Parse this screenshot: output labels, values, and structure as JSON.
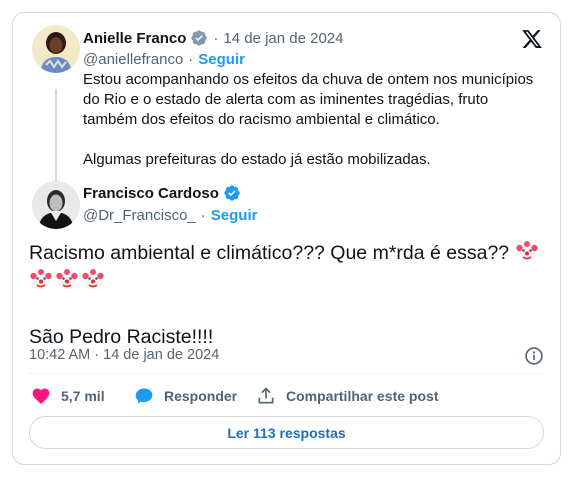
{
  "quoted_tweet": {
    "author_name": "Anielle Franco",
    "date": "14 de jan de 2024",
    "handle": "@aniellefranco",
    "separator": "·",
    "follow_label": "Seguir",
    "text_paragraph_1": "Estou acompanhando os efeitos da chuva de ontem nos municípios do Rio e o estado de alerta com as iminentes tragédias, fruto também dos efeitos do racismo ambiental e climático.",
    "text_paragraph_2": "Algumas prefeituras do estado já estão mobilizadas."
  },
  "main_tweet": {
    "author_name": "Francisco Cardoso",
    "handle": "@Dr_Francisco_",
    "separator": "·",
    "follow_label": "Seguir",
    "text_line_1": "Racismo ambiental e climático??? Que m*rda é essa??",
    "text_line_2": "São Pedro Raciste!!!!",
    "emojis": [
      "clown-face",
      "clown-face",
      "clown-face",
      "clown-face"
    ],
    "timestamp": "10:42 AM · 14 de jan de 2024"
  },
  "actions": {
    "likes": "5,7 mil",
    "reply_label": "Responder",
    "share_label": "Compartilhar este post"
  },
  "read_replies_label": "Ler 113 respostas",
  "colors": {
    "accent": "#1d9bf0",
    "like": "#f91880",
    "text": "#0f1419",
    "muted": "#536471",
    "border": "#cfd9de"
  },
  "icons": {
    "platform": "x-logo-icon",
    "verified": "verified-badge-icon",
    "info": "info-icon",
    "like": "heart-icon",
    "reply": "speech-bubble-icon",
    "share": "share-upload-icon"
  }
}
